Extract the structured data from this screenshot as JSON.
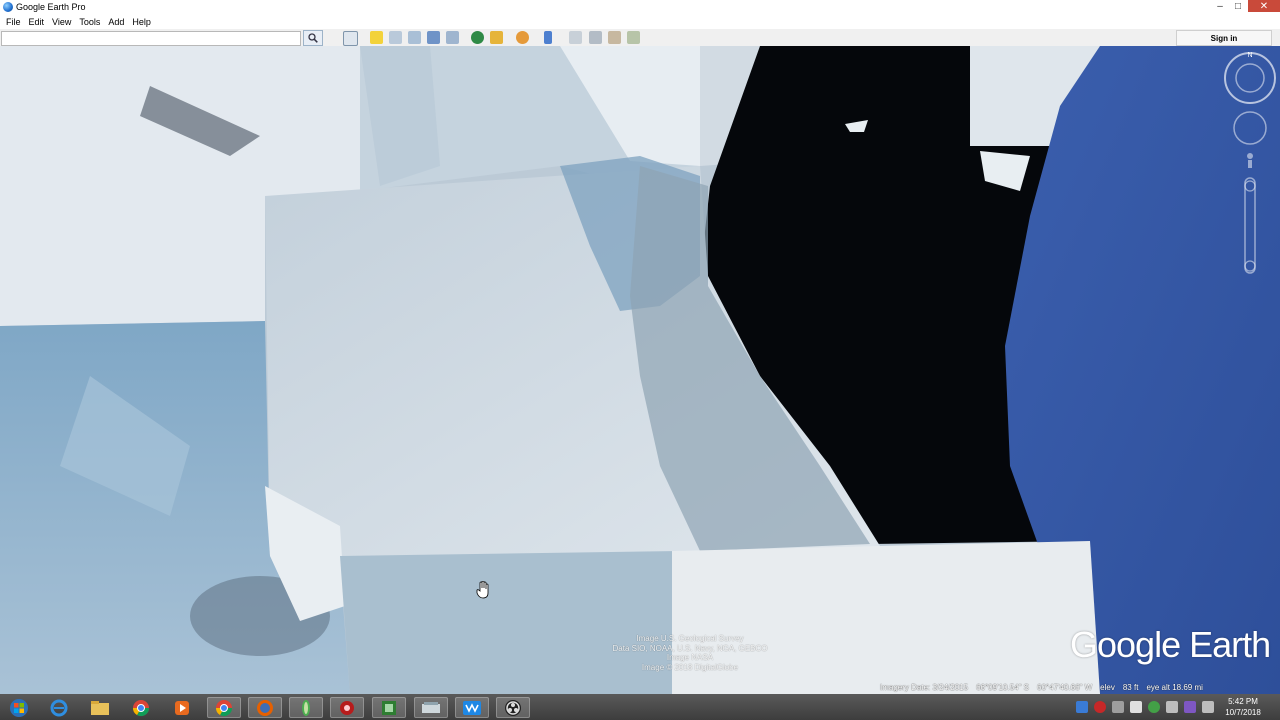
{
  "window": {
    "title": "Google Earth Pro"
  },
  "menu": [
    {
      "label": "File"
    },
    {
      "label": "Edit"
    },
    {
      "label": "View"
    },
    {
      "label": "Tools"
    },
    {
      "label": "Add"
    },
    {
      "label": "Help"
    }
  ],
  "toolbar": {
    "search_value": "",
    "signin_label": "Sign in",
    "buttons": [
      "search-icon",
      "sidebar-toggle-icon",
      "placemark-icon",
      "polygon-icon",
      "path-icon",
      "image-overlay-icon",
      "record-tour-icon",
      "historical-imagery-icon",
      "sunlight-icon",
      "planets-icon",
      "ruler-icon",
      "email-icon",
      "print-icon",
      "save-image-icon",
      "view-in-maps-icon"
    ]
  },
  "map": {
    "attribution": [
      "Image U.S. Geological Survey",
      "Data SIO, NOAA, U.S. Navy, NGA, GEBCO",
      "Image NASA",
      "Image © 2018 DigitalGlobe"
    ],
    "brand": "Google Earth",
    "compass_letter": "N"
  },
  "statusbar": {
    "imagery_date": "Imagery Date: 3/24/2015",
    "lat": "66°09'10.54\" S",
    "lon": "60°47'40.66\" W",
    "elev_label": "elev",
    "elev_value": "83 ft",
    "eye_alt": "eye alt  18.69 mi"
  },
  "taskbar": {
    "apps": [
      "start-button",
      "internet-explorer-icon",
      "file-explorer-icon",
      "chrome-icon",
      "media-player-icon",
      "chrome-icon-2",
      "firefox-icon",
      "google-earth-icon",
      "game-icon",
      "spreadsheet-icon",
      "scanner-icon",
      "screen-recorder-icon",
      "obs-icon"
    ],
    "time": "5:42 PM",
    "date": "10/7/2018"
  }
}
